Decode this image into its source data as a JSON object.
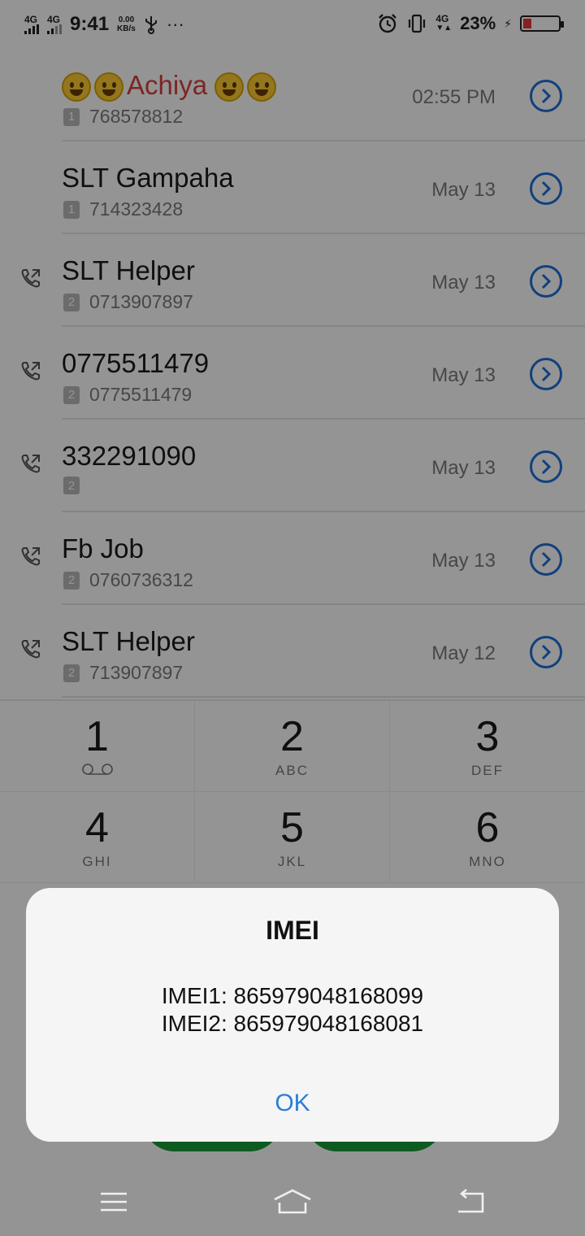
{
  "status_bar": {
    "signal1": "4G",
    "signal2": "4G",
    "time": "9:41",
    "speed_value": "0.00",
    "speed_unit": "KB/s",
    "more": "···",
    "net": "4G",
    "battery_pct": "23%",
    "battery_level": 0.23,
    "battery_color": "#e53935"
  },
  "calls": [
    {
      "name": "Achiya",
      "name_emoji_before": 2,
      "name_emoji_after": 2,
      "name_color": "#d84040",
      "sim": "1",
      "number": "768578812",
      "date": "02:55 PM",
      "outgoing": false
    },
    {
      "name": "SLT Gampaha",
      "sim": "1",
      "number": "714323428",
      "date": "May 13",
      "outgoing": false
    },
    {
      "name": "SLT Helper",
      "sim": "2",
      "number": "0713907897",
      "date": "May 13",
      "outgoing": true
    },
    {
      "name": "0775511479",
      "sim": "2",
      "number": "0775511479",
      "date": "May 13",
      "outgoing": true
    },
    {
      "name": "332291090",
      "sim": "2",
      "number": "",
      "date": "May 13",
      "outgoing": true
    },
    {
      "name": "Fb Job",
      "sim": "2",
      "number": "0760736312",
      "date": "May 13",
      "outgoing": true
    },
    {
      "name": "SLT Helper",
      "sim": "2",
      "number": "713907897",
      "date": "May 12",
      "outgoing": true
    }
  ],
  "keypad": [
    {
      "num": "1",
      "letters": "voicemail-icon"
    },
    {
      "num": "2",
      "letters": "ABC"
    },
    {
      "num": "3",
      "letters": "DEF"
    },
    {
      "num": "4",
      "letters": "GHI"
    },
    {
      "num": "5",
      "letters": "JKL"
    },
    {
      "num": "6",
      "letters": "MNO"
    }
  ],
  "dialog": {
    "title": "IMEI",
    "line1": "IMEI1: 865979048168099",
    "line2": "IMEI2: 865979048168081",
    "ok_label": "OK"
  },
  "colors": {
    "accent_blue": "#1e6fd9",
    "call_green": "#1a9c3a",
    "ok_blue": "#2a7fd8"
  },
  "nav": [
    "menu-icon",
    "home-icon",
    "back-icon"
  ]
}
